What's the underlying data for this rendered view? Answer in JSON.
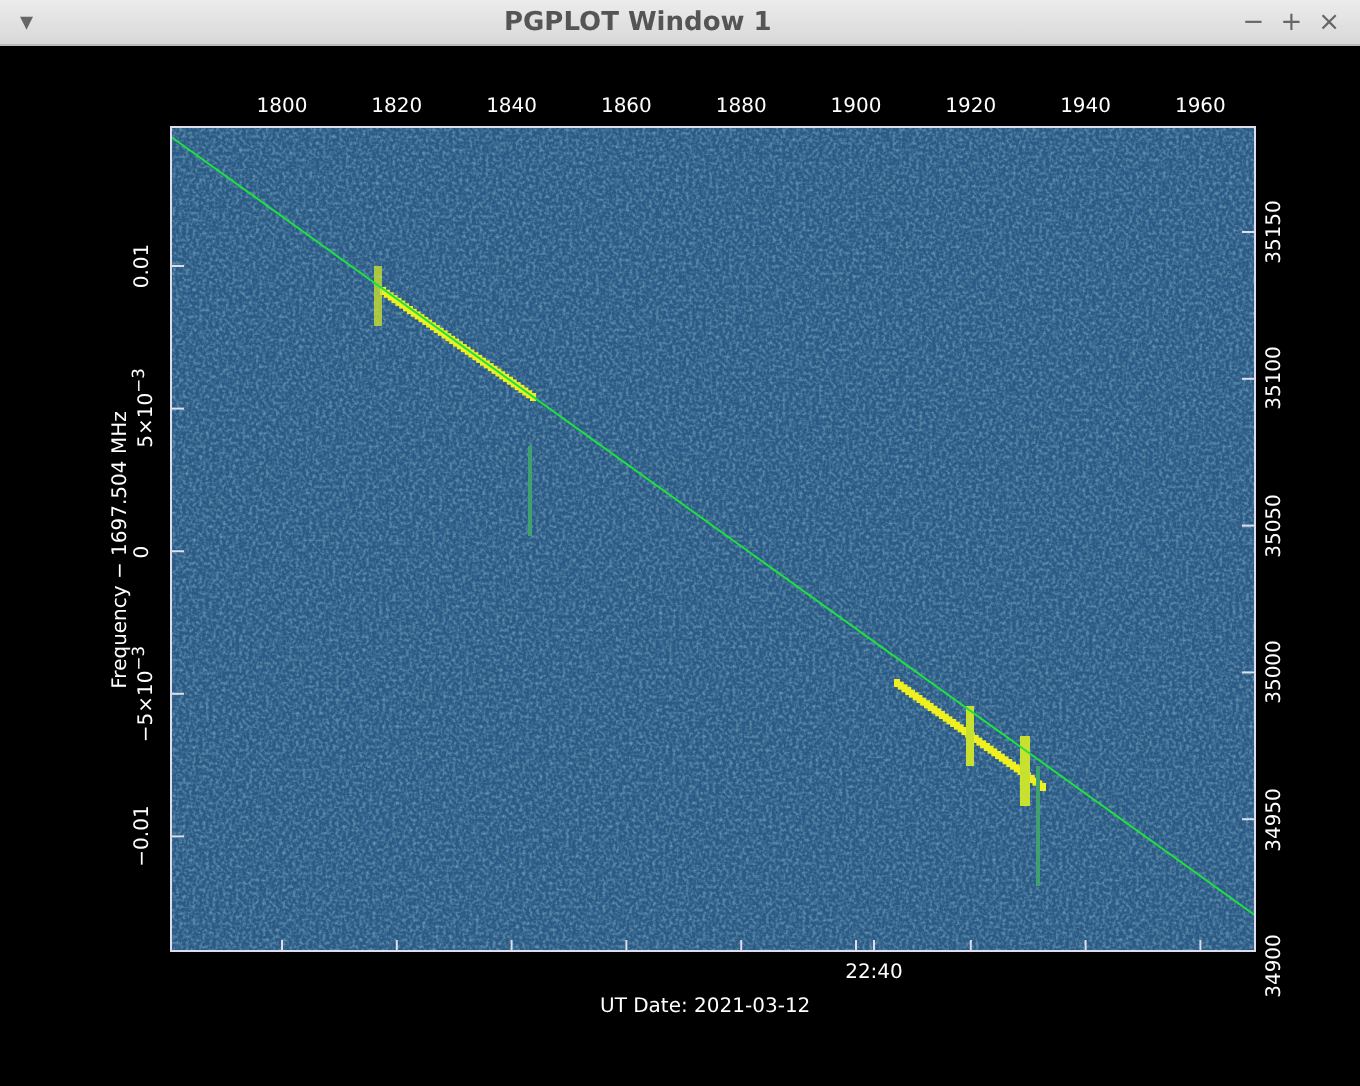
{
  "window": {
    "title": "PGPLOT Window 1",
    "menu_glyph": "▾",
    "controls": [
      "−",
      "+",
      "×"
    ]
  },
  "plot": {
    "top_ticks": [
      "1800",
      "1820",
      "1840",
      "1860",
      "1880",
      "1900",
      "1920",
      "1940",
      "1960"
    ],
    "left_ticks": [
      "0.01",
      "5×10$^{−3}$",
      "0",
      "−5×10$^{−3}$",
      "−0.01"
    ],
    "right_ticks": [
      "35150",
      "35100",
      "35050",
      "35000",
      "34950",
      "34900"
    ],
    "bottom_ticks": [
      "22:40"
    ],
    "ylabel": "Frequency − 1697.504 MHz",
    "xlabel": "UT Date: 2021-03-12"
  }
}
